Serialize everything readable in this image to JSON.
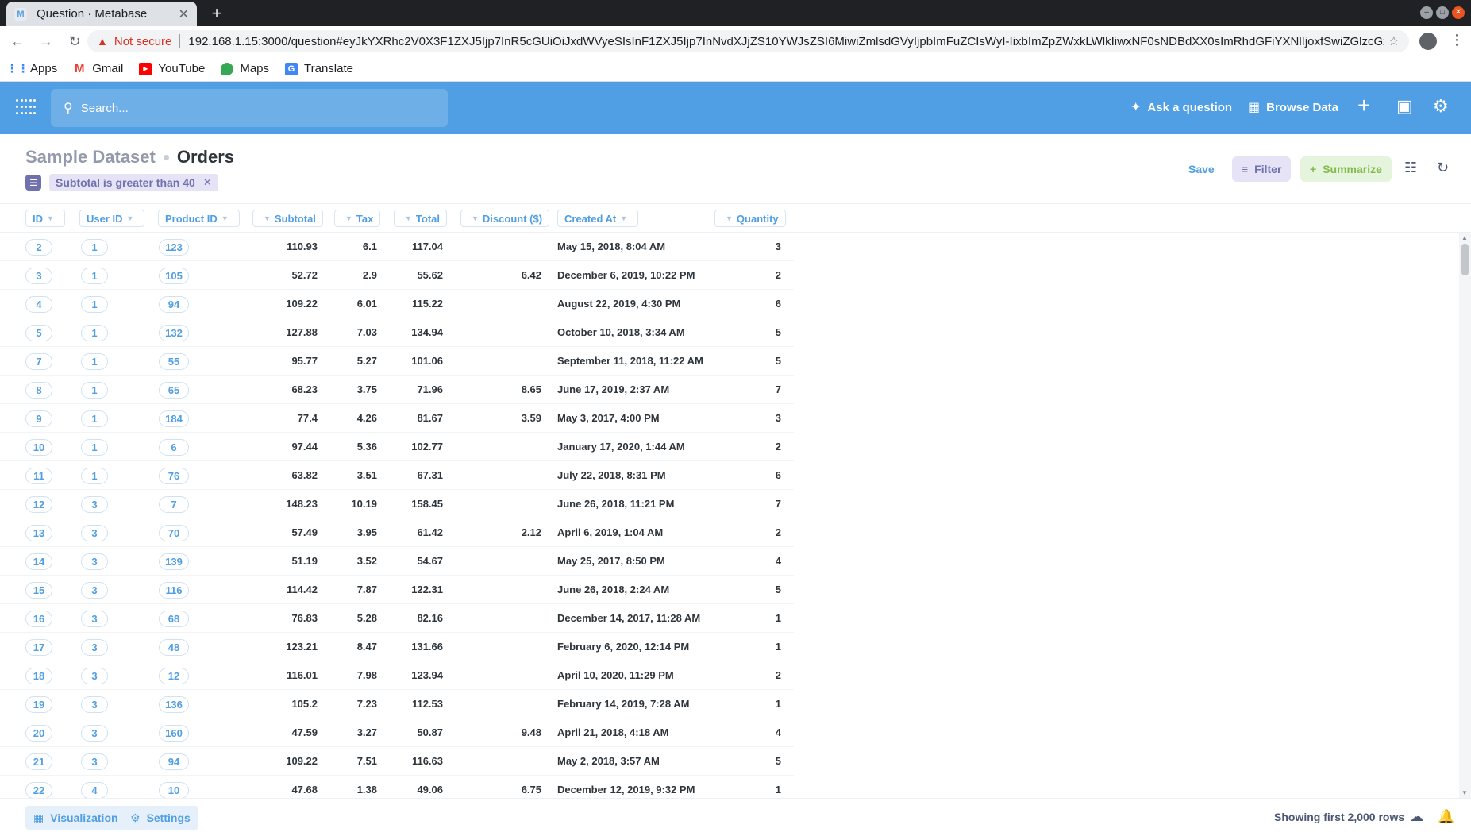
{
  "browser": {
    "tab_title": "Question · Metabase",
    "favicon": "M",
    "new_tab": "+",
    "not_secure": "Not secure",
    "url": "192.168.1.15:3000/question#eyJkYXRhc2V0X3F1ZXJ5Ijp7InR5cGUiOiJxdWVyeSIsInF1ZXJ5Ijp7InNvdXJjZS10YWJsZSI6MiwiZmlsdGVyIjpbImFuZCIsWyI-IixbImZpZWxkLWlkIiwxNF0sNDBdXX0sImRhdGFiYXNlIjoxfSwiZGlzcGxheSI6InRhYmxl...",
    "bookmarks": [
      {
        "label": "Apps",
        "color": "#4285f4"
      },
      {
        "label": "Gmail",
        "color": "#ea4335"
      },
      {
        "label": "YouTube",
        "color": "#ff0000"
      },
      {
        "label": "Maps",
        "color": "#34a853"
      },
      {
        "label": "Translate",
        "color": "#4285f4"
      }
    ]
  },
  "nav": {
    "search_placeholder": "Search...",
    "ask_question": "Ask a question",
    "browse_data": "Browse Data",
    "accent": "#509ee3"
  },
  "header": {
    "dataset": "Sample Dataset",
    "table": "Orders",
    "filter_label": "Subtotal is greater than 40",
    "save": "Save",
    "filter": "Filter",
    "summarize": "Summarize"
  },
  "table": {
    "columns": [
      "ID",
      "User ID",
      "Product ID",
      "Subtotal",
      "Tax",
      "Total",
      "Discount ($)",
      "Created At",
      "Quantity"
    ],
    "rows": [
      [
        "2",
        "1",
        "123",
        "110.93",
        "6.1",
        "117.04",
        "",
        "May 15, 2018, 8:04 AM",
        "3"
      ],
      [
        "3",
        "1",
        "105",
        "52.72",
        "2.9",
        "55.62",
        "6.42",
        "December 6, 2019, 10:22 PM",
        "2"
      ],
      [
        "4",
        "1",
        "94",
        "109.22",
        "6.01",
        "115.22",
        "",
        "August 22, 2019, 4:30 PM",
        "6"
      ],
      [
        "5",
        "1",
        "132",
        "127.88",
        "7.03",
        "134.94",
        "",
        "October 10, 2018, 3:34 AM",
        "5"
      ],
      [
        "7",
        "1",
        "55",
        "95.77",
        "5.27",
        "101.06",
        "",
        "September 11, 2018, 11:22 AM",
        "5"
      ],
      [
        "8",
        "1",
        "65",
        "68.23",
        "3.75",
        "71.96",
        "8.65",
        "June 17, 2019, 2:37 AM",
        "7"
      ],
      [
        "9",
        "1",
        "184",
        "77.4",
        "4.26",
        "81.67",
        "3.59",
        "May 3, 2017, 4:00 PM",
        "3"
      ],
      [
        "10",
        "1",
        "6",
        "97.44",
        "5.36",
        "102.77",
        "",
        "January 17, 2020, 1:44 AM",
        "2"
      ],
      [
        "11",
        "1",
        "76",
        "63.82",
        "3.51",
        "67.31",
        "",
        "July 22, 2018, 8:31 PM",
        "6"
      ],
      [
        "12",
        "3",
        "7",
        "148.23",
        "10.19",
        "158.45",
        "",
        "June 26, 2018, 11:21 PM",
        "7"
      ],
      [
        "13",
        "3",
        "70",
        "57.49",
        "3.95",
        "61.42",
        "2.12",
        "April 6, 2019, 1:04 AM",
        "2"
      ],
      [
        "14",
        "3",
        "139",
        "51.19",
        "3.52",
        "54.67",
        "",
        "May 25, 2017, 8:50 PM",
        "4"
      ],
      [
        "15",
        "3",
        "116",
        "114.42",
        "7.87",
        "122.31",
        "",
        "June 26, 2018, 2:24 AM",
        "5"
      ],
      [
        "16",
        "3",
        "68",
        "76.83",
        "5.28",
        "82.16",
        "",
        "December 14, 2017, 11:28 AM",
        "1"
      ],
      [
        "17",
        "3",
        "48",
        "123.21",
        "8.47",
        "131.66",
        "",
        "February 6, 2020, 12:14 PM",
        "1"
      ],
      [
        "18",
        "3",
        "12",
        "116.01",
        "7.98",
        "123.94",
        "",
        "April 10, 2020, 11:29 PM",
        "2"
      ],
      [
        "19",
        "3",
        "136",
        "105.2",
        "7.23",
        "112.53",
        "",
        "February 14, 2019, 7:28 AM",
        "1"
      ],
      [
        "20",
        "3",
        "160",
        "47.59",
        "3.27",
        "50.87",
        "9.48",
        "April 21, 2018, 4:18 AM",
        "4"
      ],
      [
        "21",
        "3",
        "94",
        "109.22",
        "7.51",
        "116.63",
        "",
        "May 2, 2018, 3:57 AM",
        "5"
      ],
      [
        "22",
        "4",
        "10",
        "47.68",
        "1.38",
        "49.06",
        "6.75",
        "December 12, 2019, 9:32 PM",
        "1"
      ]
    ]
  },
  "footer": {
    "visualization": "Visualization",
    "settings": "Settings",
    "row_count": "Showing first 2,000 rows"
  }
}
